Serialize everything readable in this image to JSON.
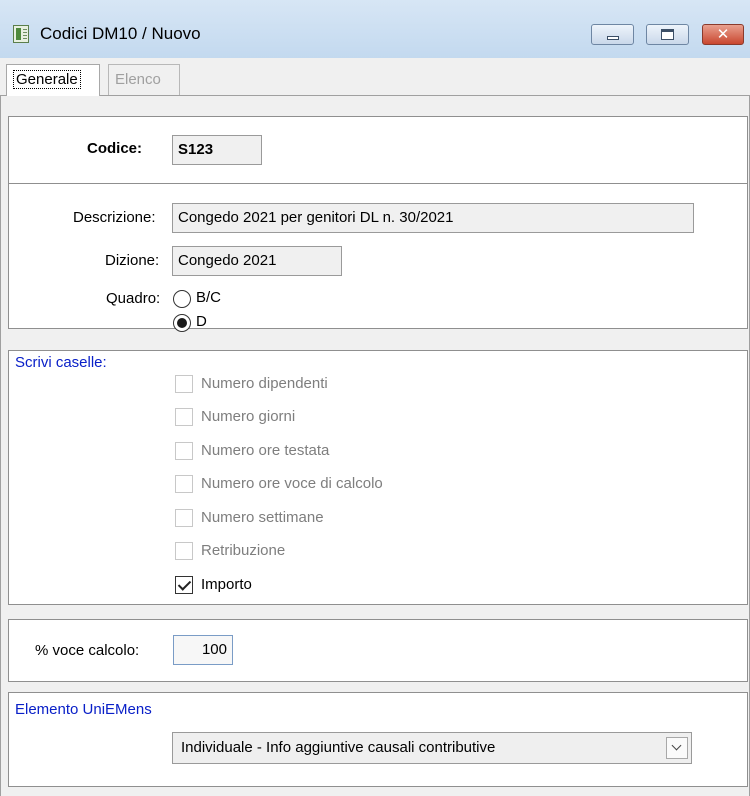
{
  "window": {
    "title": "Codici DM10 / Nuovo",
    "close_glyph": "✕"
  },
  "tabs": [
    {
      "label": "Generale",
      "active": true
    },
    {
      "label": "Elenco",
      "active": false
    }
  ],
  "codice": {
    "label": "Codice:",
    "value": "S123"
  },
  "descrizione": {
    "label": "Descrizione:",
    "value": "Congedo 2021 per genitori DL n. 30/2021"
  },
  "dizione": {
    "label": "Dizione:",
    "value": "Congedo 2021"
  },
  "quadro": {
    "label": "Quadro:",
    "options": [
      {
        "label": "B/C",
        "selected": false
      },
      {
        "label": "D",
        "selected": true
      }
    ]
  },
  "scrivi_caselle": {
    "title": "Scrivi caselle:",
    "items": [
      {
        "label": "Numero dipendenti",
        "checked": false,
        "enabled": false
      },
      {
        "label": "Numero giorni",
        "checked": false,
        "enabled": false
      },
      {
        "label": "Numero ore testata",
        "checked": false,
        "enabled": false
      },
      {
        "label": "Numero ore voce di calcolo",
        "checked": false,
        "enabled": false
      },
      {
        "label": "Numero settimane",
        "checked": false,
        "enabled": false
      },
      {
        "label": "Retribuzione",
        "checked": false,
        "enabled": false
      },
      {
        "label": "Importo",
        "checked": true,
        "enabled": true
      }
    ]
  },
  "voce_calcolo": {
    "label": "% voce calcolo:",
    "value": "100"
  },
  "uniemens": {
    "title": "Elemento UniEMens",
    "selected": "Individuale - Info aggiuntive causali contributive"
  },
  "colors": {
    "group_title": "#0a20c8",
    "disabled_text": "#7e7e7e"
  }
}
